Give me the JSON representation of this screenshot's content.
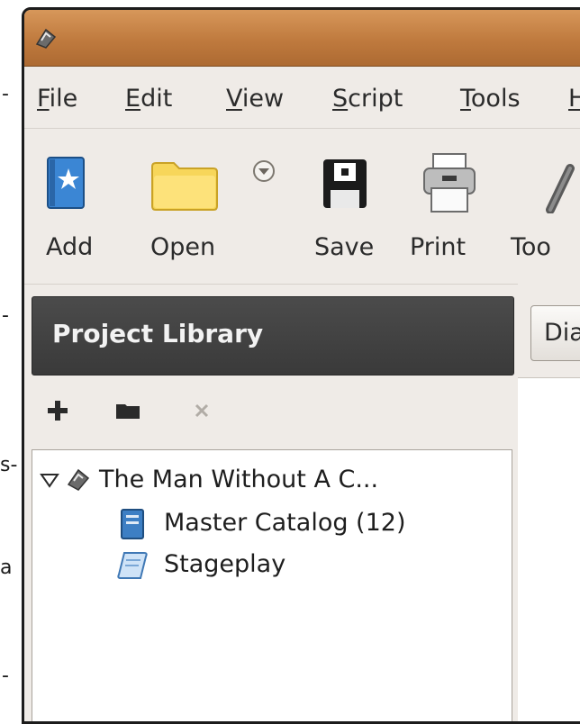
{
  "edge_marks": [
    "-",
    "-",
    "s-",
    "a",
    "-"
  ],
  "menubar": {
    "items": [
      {
        "key": "F",
        "rest": "ile"
      },
      {
        "key": "E",
        "rest": "dit"
      },
      {
        "key": "V",
        "rest": "iew"
      },
      {
        "key": "S",
        "rest": "cript"
      },
      {
        "key": "T",
        "rest": "ools"
      },
      {
        "key": "H",
        "rest": ""
      }
    ]
  },
  "toolbar": {
    "add_label": "Add",
    "open_label": "Open",
    "save_label": "Save",
    "print_label": "Print",
    "tools_label": "Too"
  },
  "sidebar": {
    "title": "Project Library",
    "tree": [
      {
        "label": "The Man Without A C...",
        "icon": "project-icon",
        "expanded": true
      },
      {
        "label": "Master Catalog (12)",
        "icon": "catalog-icon"
      },
      {
        "label": "Stageplay",
        "icon": "script-icon"
      }
    ]
  },
  "content": {
    "tab_label": "Dia"
  },
  "colors": {
    "titlebar": "#c0803f",
    "sidebar_header": "#404040",
    "add_icon": "#2f78c7",
    "folder": "#f7d65a"
  }
}
